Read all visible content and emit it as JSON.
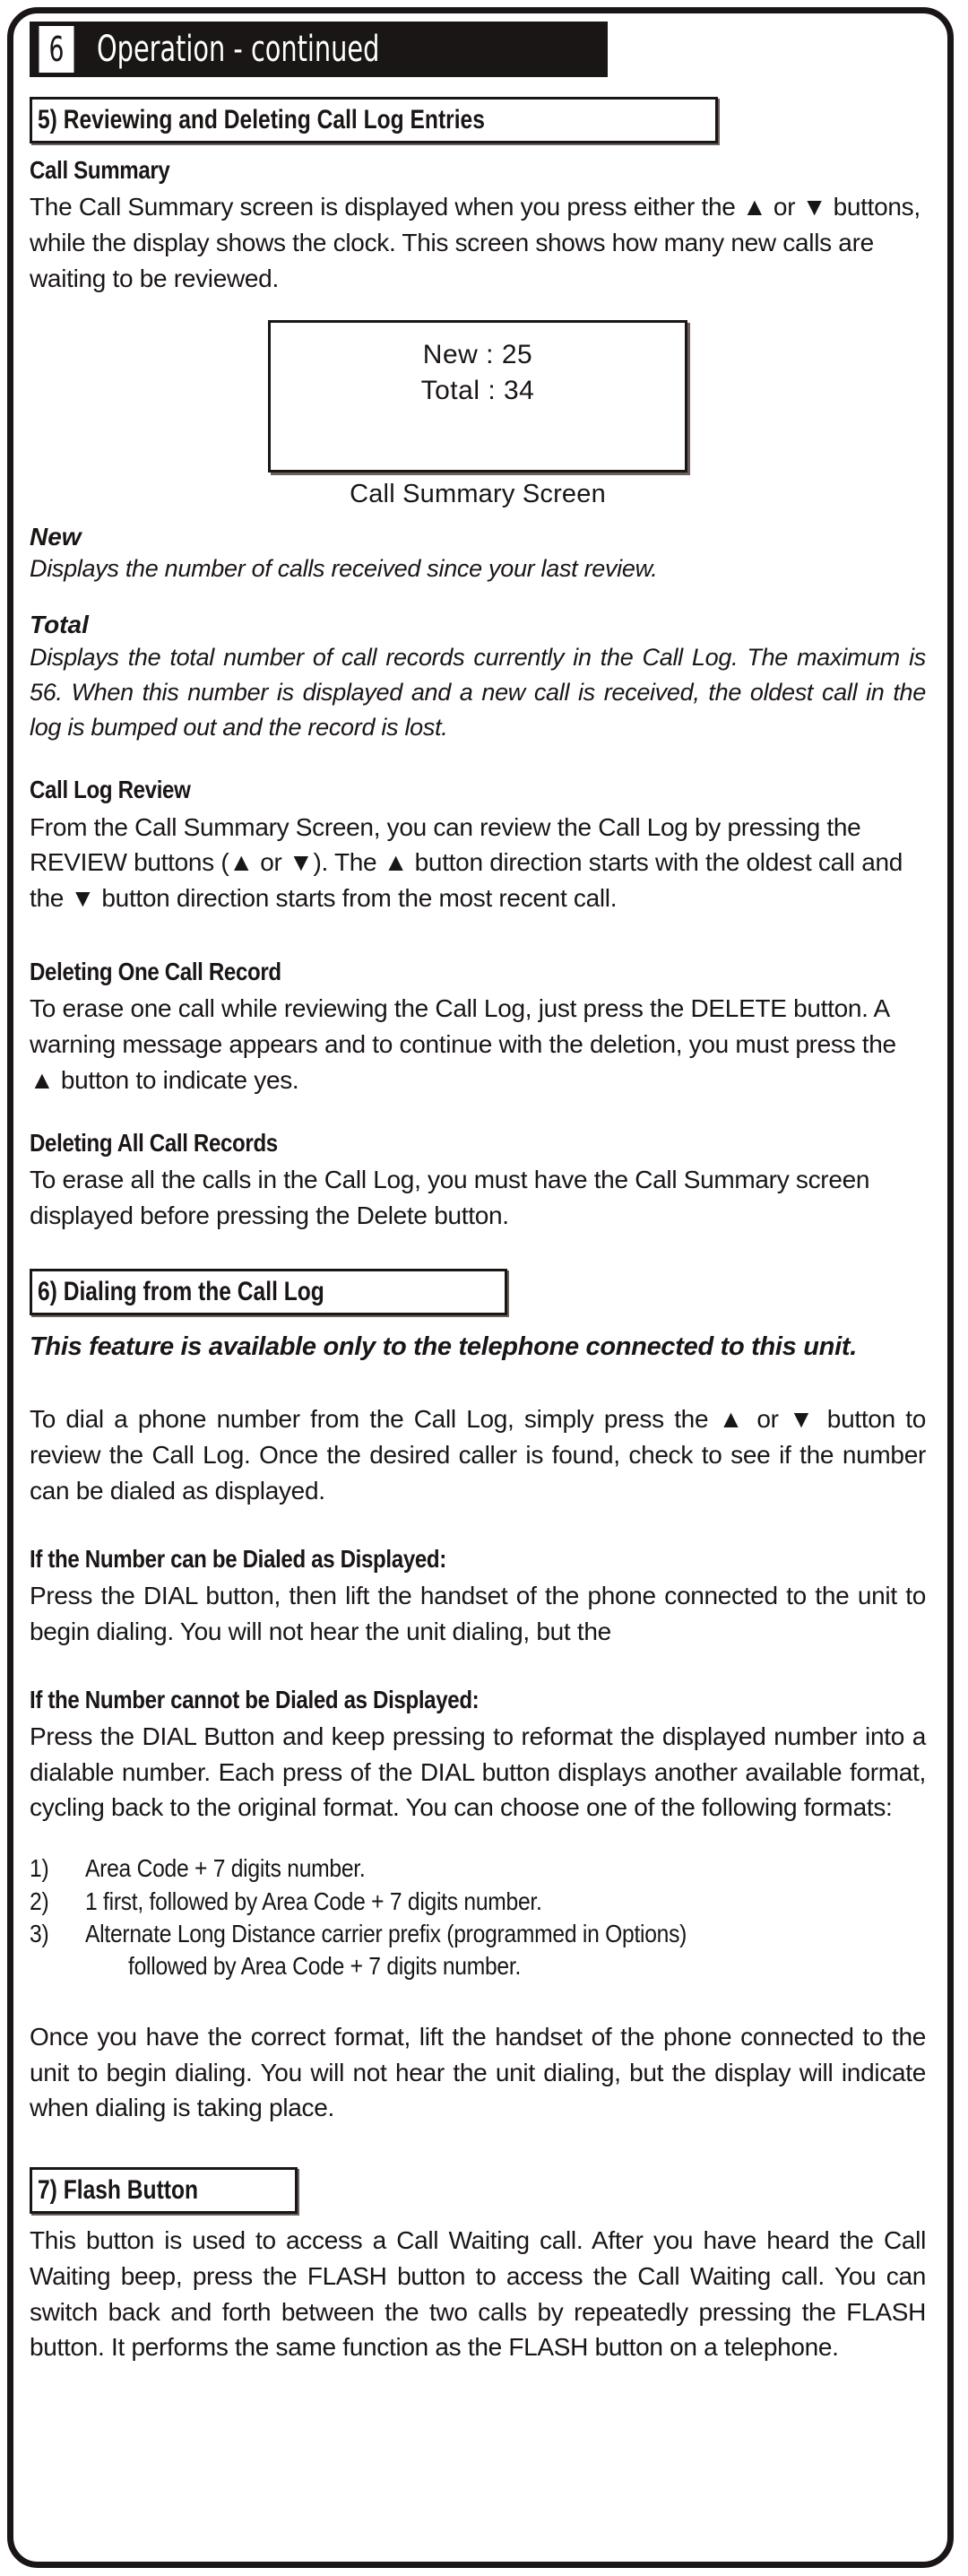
{
  "page": {
    "chapter_number": "6",
    "chapter_title": "Operation - continued"
  },
  "sections": {
    "sec5": {
      "heading": "5) Reviewing and Deleting Call Log Entries",
      "call_summary": {
        "heading": "Call Summary",
        "paragraph": "The Call Summary screen is displayed when you press either the ▲ or ▼ buttons, while the display shows the clock.   This screen shows how many new calls are waiting to be reviewed."
      },
      "lcd_figure": {
        "line1": "New : 25",
        "line2": "Total : 34",
        "caption": "Call Summary Screen"
      },
      "new_def": {
        "term": "New",
        "definition": "Displays the number of calls received since your last review."
      },
      "total_def": {
        "term": "Total",
        "definition": "Displays the total number of call records currently in the Call Log. The maximum is 56. When this number is displayed and a new call is received, the oldest call in the log is bumped out and the record is lost."
      },
      "call_log_review": {
        "heading": "Call Log Review",
        "paragraph": "From the Call Summary Screen, you can review the Call Log by pressing the REVIEW buttons (▲ or ▼).  The ▲ button direction starts with the oldest call and the ▼ button direction starts from the most recent call."
      },
      "deleting_one": {
        "heading": "Deleting One Call Record",
        "paragraph": "To erase one call while reviewing the Call Log, just press the DELETE button.  A warning message appears and to continue with the deletion, you must press the ▲ button  to indicate yes."
      },
      "deleting_all": {
        "heading": "Deleting All Call Records",
        "paragraph": "To erase all the calls in the Call Log, you must have the Call Summary screen displayed before pressing the Delete button."
      }
    },
    "sec6": {
      "heading": "6) Dialing from the Call Log",
      "note": "This feature is available only to the telephone connected to this unit.",
      "intro": "To dial a phone number from the Call Log, simply press the ▲ or ▼ button to review the Call Log.  Once the desired caller is found, check to see if the number can be dialed as displayed.",
      "can_be_dialed": {
        "heading": "If the Number can be Dialed as Displayed:",
        "paragraph": "Press the DIAL button, then lift the handset of the phone connected to the unit to begin dialing. You will not hear the unit dialing, but the"
      },
      "cannot_be_dialed": {
        "heading": "If the Number cannot be Dialed as Displayed:",
        "paragraph": "Press the DIAL Button and keep pressing to reformat the displayed number into a dialable number. Each press of the DIAL button displays another available format, cycling back to the original format.  You can choose one of the following formats:"
      },
      "formats": [
        {
          "num": "1)",
          "text": "Area Code + 7 digits number.",
          "cont": ""
        },
        {
          "num": "2)",
          "text": "1 first, followed by Area Code + 7 digits number.",
          "cont": ""
        },
        {
          "num": "3)",
          "text": "Alternate Long Distance carrier prefix  (programmed in Options)",
          "cont": "followed by Area Code + 7 digits number."
        }
      ],
      "closing": "Once you have the correct format, lift the handset of the phone connected to the unit to begin dialing. You will not hear the unit dialing, but the display will indicate when dialing is taking place."
    },
    "sec7": {
      "heading": "7) Flash Button",
      "paragraph": "This button is used to access a Call Waiting call. After you have heard the Call Waiting beep, press the FLASH button to access the Call Waiting call. You can switch back and forth between the two calls by repeatedly pressing the FLASH button. It performs the same function as the FLASH button on a telephone."
    }
  },
  "colors": {
    "ink": "#1a1615",
    "paper": "#ffffff",
    "shadow": "#6b5f5c"
  }
}
